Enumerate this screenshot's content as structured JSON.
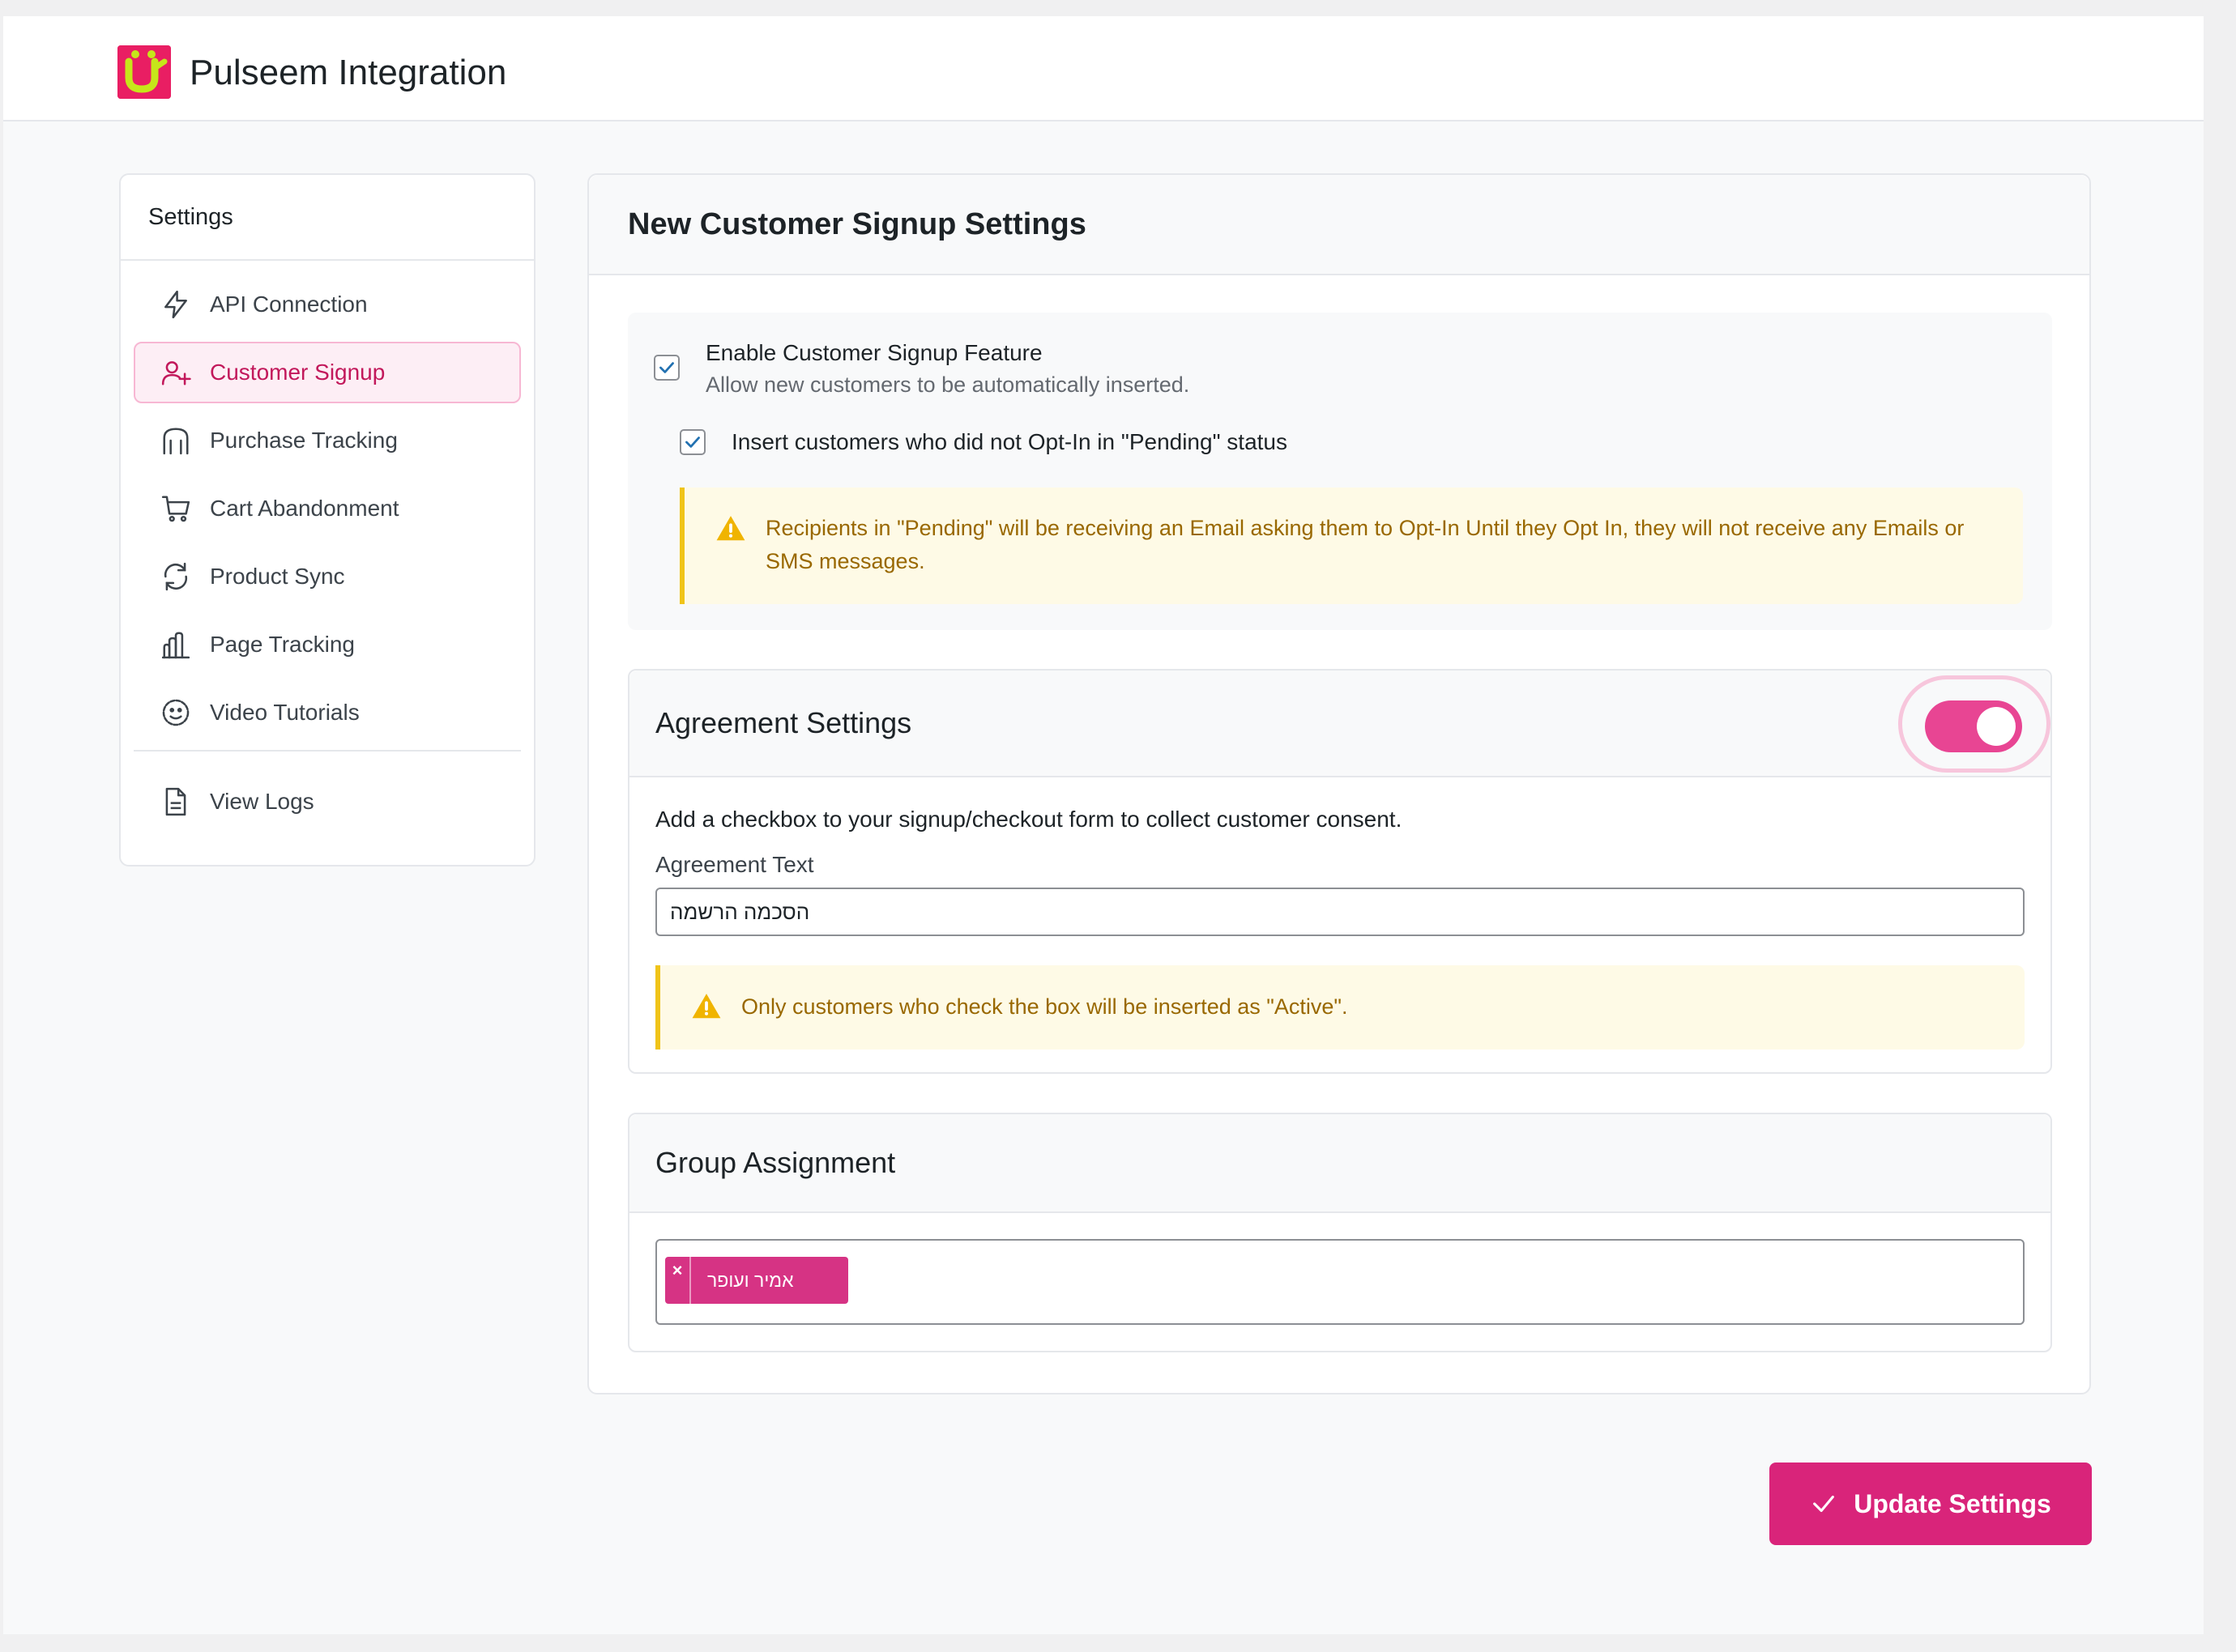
{
  "header": {
    "title": "Pulseem Integration",
    "logo_icon": "pulseem-logo-icon"
  },
  "sidebar": {
    "title": "Settings",
    "items": [
      {
        "label": "API Connection",
        "icon": "lightning-icon",
        "active": false
      },
      {
        "label": "Customer Signup",
        "icon": "user-plus-icon",
        "active": true
      },
      {
        "label": "Purchase Tracking",
        "icon": "shopping-bag-icon",
        "active": false
      },
      {
        "label": "Cart Abandonment",
        "icon": "cart-icon",
        "active": false
      },
      {
        "label": "Product Sync",
        "icon": "sync-icon",
        "active": false
      },
      {
        "label": "Page Tracking",
        "icon": "chart-icon",
        "active": false
      },
      {
        "label": "Video Tutorials",
        "icon": "smile-icon",
        "active": false
      },
      {
        "label": "View Logs",
        "icon": "document-icon",
        "active": false
      }
    ]
  },
  "main": {
    "title": "New Customer Signup Settings",
    "signup": {
      "enable_label": "Enable Customer Signup Feature",
      "enable_desc": "Allow new customers to be automatically inserted.",
      "enable_checked": true,
      "pending_label": "Insert customers who did not Opt-In in \"Pending\" status",
      "pending_checked": true,
      "pending_notice": "Recipients in \"Pending\" will be receiving an Email asking them to Opt-In Until they Opt In, they will not receive any Emails or SMS messages."
    },
    "agreement": {
      "title": "Agreement Settings",
      "toggle_on": true,
      "description": "Add a checkbox to your signup/checkout form to collect customer consent.",
      "text_label": "Agreement Text",
      "text_value": "הסכמה הרשמה",
      "notice": "Only customers who check the box will be inserted as \"Active\"."
    },
    "group": {
      "title": "Group Assignment",
      "tags": [
        "אמיר ועופר"
      ],
      "remove_symbol": "×"
    }
  },
  "actions": {
    "update_label": "Update Settings"
  },
  "colors": {
    "accent": "#d9247a",
    "accent_light": "#fdeef5",
    "warning_bg": "#fefae6",
    "warning_border": "#f0c419",
    "warning_text": "#996800"
  }
}
